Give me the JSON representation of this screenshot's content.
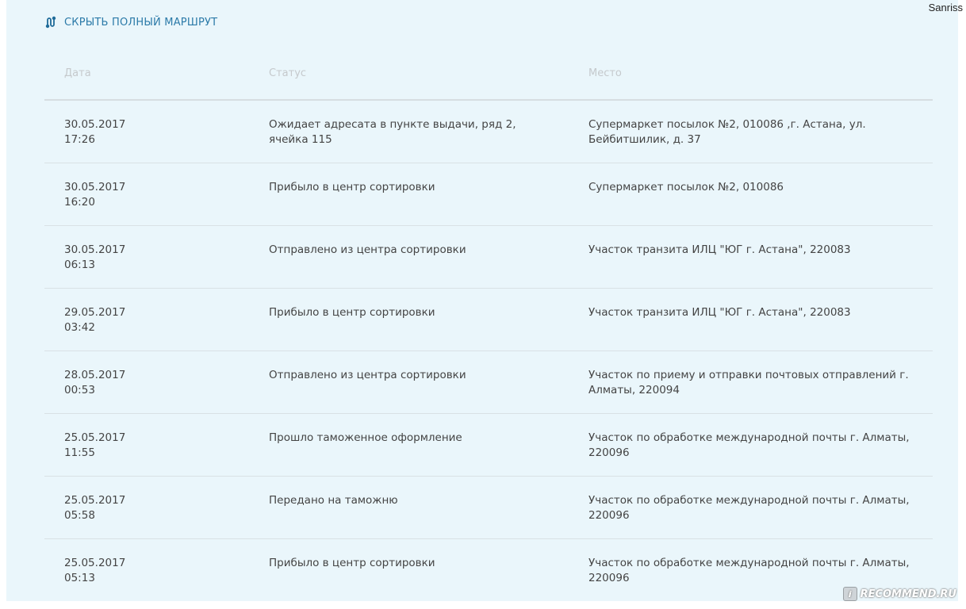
{
  "user": {
    "name": "Sanriss"
  },
  "toggle": {
    "label": "СКРЫТЬ ПОЛНЫЙ МАРШРУТ",
    "icon": "route-icon"
  },
  "table": {
    "headers": {
      "date": "Дата",
      "status": "Статус",
      "place": "Место"
    },
    "rows": [
      {
        "date": "30.05.2017",
        "time": "17:26",
        "status": "Ожидает адресата в пункте выдачи, ряд 2, ячейка 115",
        "place": "Супермаркет посылок №2, 010086 ,г. Астана, ул. Бейбитшилик, д. 37"
      },
      {
        "date": "30.05.2017",
        "time": "16:20",
        "status": "Прибыло в центр сортировки",
        "place": "Супермаркет посылок №2, 010086"
      },
      {
        "date": "30.05.2017",
        "time": "06:13",
        "status": "Отправлено из центра сортировки",
        "place": "Участок транзита ИЛЦ \"ЮГ г. Астана\", 220083"
      },
      {
        "date": "29.05.2017",
        "time": "03:42",
        "status": "Прибыло в центр сортировки",
        "place": "Участок транзита ИЛЦ \"ЮГ г. Астана\", 220083"
      },
      {
        "date": "28.05.2017",
        "time": "00:53",
        "status": "Отправлено из центра сортировки",
        "place": "Участок по приему и отправки почтовых отправлений г. Алматы, 220094"
      },
      {
        "date": "25.05.2017",
        "time": "11:55",
        "status": "Прошло таможенное оформление",
        "place": "Участок по обработке международной почты г. Алматы, 220096"
      },
      {
        "date": "25.05.2017",
        "time": "05:58",
        "status": "Передано на таможню",
        "place": "Участок по обработке международной почты г. Алматы, 220096"
      },
      {
        "date": "25.05.2017",
        "time": "05:13",
        "status": "Прибыло в центр сортировки",
        "place": "Участок по обработке международной почты г. Алматы, 220096"
      }
    ]
  },
  "watermark": {
    "text": "RECOMMEND.RU"
  },
  "colors": {
    "panel_bg": "#eaf6fb",
    "link": "#2b7aa8",
    "header_text": "#c5c9cc",
    "body_text": "#444444"
  }
}
